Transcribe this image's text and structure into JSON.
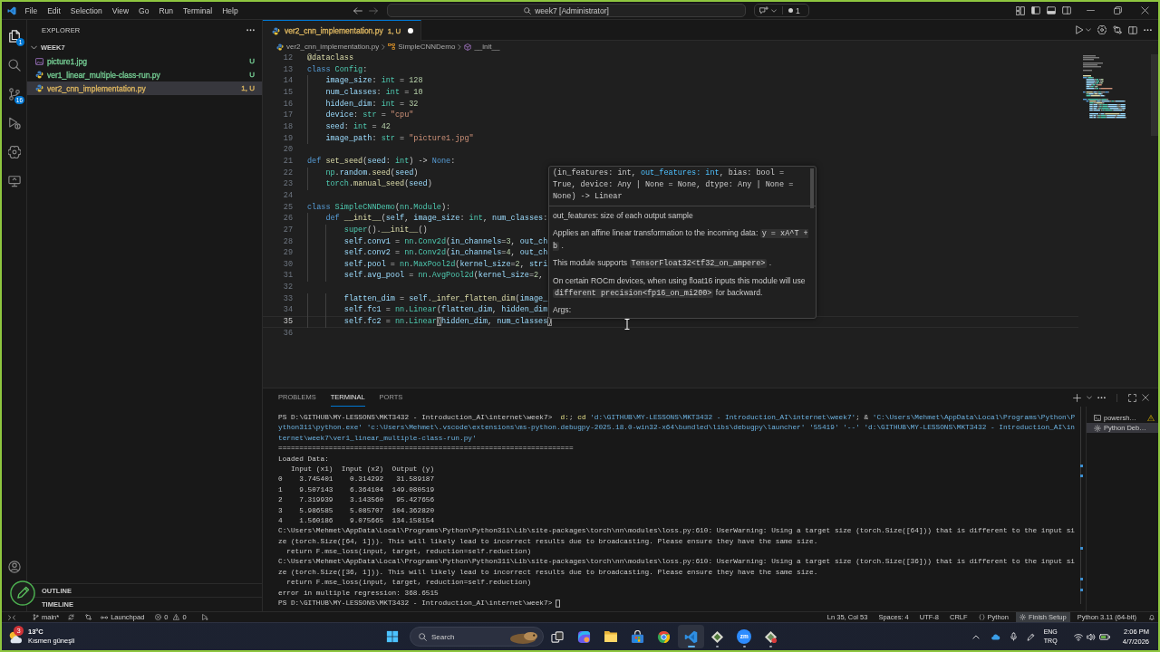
{
  "title_bar": {
    "menu": [
      "File",
      "Edit",
      "Selection",
      "View",
      "Go",
      "Run",
      "Terminal",
      "Help"
    ],
    "command_center": "week7 [Administrator]",
    "notification_count": "1"
  },
  "activity_bar": {
    "items": [
      {
        "kind": "files",
        "badge": "1",
        "selected": true
      },
      {
        "kind": "search",
        "selected": false
      },
      {
        "kind": "source_control",
        "badge": "16",
        "selected": false
      },
      {
        "kind": "run_debug",
        "selected": false
      },
      {
        "kind": "assistant",
        "selected": false
      },
      {
        "kind": "remote",
        "selected": false
      }
    ],
    "bottom": [
      {
        "kind": "account"
      }
    ]
  },
  "overlay_tool": {
    "kind": "pen"
  },
  "sidebar": {
    "title": "EXPLORER",
    "folder": {
      "name": "WEEK7",
      "expanded": true
    },
    "files": [
      {
        "kind": "image",
        "name": "picture1.jpg",
        "status": "U",
        "color": "#73c991",
        "selected": false
      },
      {
        "kind": "python",
        "name": "ver1_linear_multiple-class-run.py",
        "status": "U",
        "color": "#73c991",
        "selected": false
      },
      {
        "kind": "python",
        "name": "ver2_cnn_implementation.py",
        "status": "1, U",
        "color": "#d9b35f",
        "selected": true
      }
    ],
    "sections": [
      "OUTLINE",
      "TIMELINE"
    ]
  },
  "editor": {
    "tabs": [
      {
        "name": "ver2_cnn_implementation.py",
        "status": "1, U",
        "color": "#d9b35f",
        "modified": true,
        "selected": true
      }
    ],
    "breadcrumb": [
      {
        "kind": "file",
        "text": "ver2_cnn_implementation.py"
      },
      {
        "kind": "class",
        "text": "SimpleCNNDemo"
      },
      {
        "kind": "method",
        "text": "__init__"
      }
    ],
    "lines": [
      {
        "number": "12",
        "current": false,
        "tokens": [
          {
            "kind": "function",
            "text": "@dataclass"
          }
        ]
      },
      {
        "number": "13",
        "current": false,
        "tokens": [
          {
            "kind": "keyword",
            "text": "class"
          },
          {
            "kind": "type",
            "text": " Config"
          },
          {
            "kind": "plain",
            "text": ":"
          }
        ]
      },
      {
        "number": "14",
        "current": false,
        "tokens": [
          {
            "kind": "variable",
            "text": "    image_size"
          },
          {
            "kind": "plain",
            "text": ": "
          },
          {
            "kind": "type",
            "text": "int"
          },
          {
            "kind": "plain",
            "text": " = "
          },
          {
            "kind": "number",
            "text": "128"
          }
        ]
      },
      {
        "number": "15",
        "current": false,
        "tokens": [
          {
            "kind": "variable",
            "text": "    num_classes"
          },
          {
            "kind": "plain",
            "text": ": "
          },
          {
            "kind": "type",
            "text": "int"
          },
          {
            "kind": "plain",
            "text": " = "
          },
          {
            "kind": "number",
            "text": "10"
          }
        ]
      },
      {
        "number": "16",
        "current": false,
        "tokens": [
          {
            "kind": "variable",
            "text": "    hidden_dim"
          },
          {
            "kind": "plain",
            "text": ": "
          },
          {
            "kind": "type",
            "text": "int"
          },
          {
            "kind": "plain",
            "text": " = "
          },
          {
            "kind": "number",
            "text": "32"
          }
        ]
      },
      {
        "number": "17",
        "current": false,
        "tokens": [
          {
            "kind": "variable",
            "text": "    device"
          },
          {
            "kind": "plain",
            "text": ": "
          },
          {
            "kind": "type",
            "text": "str"
          },
          {
            "kind": "plain",
            "text": " = "
          },
          {
            "kind": "string",
            "text": "\"cpu\""
          }
        ]
      },
      {
        "number": "18",
        "current": false,
        "tokens": [
          {
            "kind": "variable",
            "text": "    seed"
          },
          {
            "kind": "plain",
            "text": ": "
          },
          {
            "kind": "type",
            "text": "int"
          },
          {
            "kind": "plain",
            "text": " = "
          },
          {
            "kind": "number",
            "text": "42"
          }
        ]
      },
      {
        "number": "19",
        "current": false,
        "tokens": [
          {
            "kind": "variable",
            "text": "    image_path"
          },
          {
            "kind": "plain",
            "text": ": "
          },
          {
            "kind": "type",
            "text": "str"
          },
          {
            "kind": "plain",
            "text": " = "
          },
          {
            "kind": "string",
            "text": "\"picture1.jpg\""
          }
        ]
      },
      {
        "number": "20",
        "current": false
      },
      {
        "number": "21",
        "current": false,
        "tokens": [
          {
            "kind": "keyword",
            "text": "def"
          },
          {
            "kind": "function",
            "text": " set_seed"
          },
          {
            "kind": "plain",
            "text": "("
          },
          {
            "kind": "variable",
            "text": "seed"
          },
          {
            "kind": "plain",
            "text": ": "
          },
          {
            "kind": "type",
            "text": "int"
          },
          {
            "kind": "plain",
            "text": ") -> "
          },
          {
            "kind": "keyword",
            "text": "None"
          },
          {
            "kind": "plain",
            "text": ":"
          }
        ]
      },
      {
        "number": "22",
        "current": false,
        "tokens": [
          {
            "kind": "type",
            "text": "    np"
          },
          {
            "kind": "plain",
            "text": "."
          },
          {
            "kind": "variable",
            "text": "random"
          },
          {
            "kind": "plain",
            "text": "."
          },
          {
            "kind": "function",
            "text": "seed"
          },
          {
            "kind": "plain",
            "text": "("
          },
          {
            "kind": "variable",
            "text": "seed"
          },
          {
            "kind": "plain",
            "text": ")"
          }
        ]
      },
      {
        "number": "23",
        "current": false,
        "tokens": [
          {
            "kind": "type",
            "text": "    torch"
          },
          {
            "kind": "plain",
            "text": "."
          },
          {
            "kind": "function",
            "text": "manual_seed"
          },
          {
            "kind": "plain",
            "text": "("
          },
          {
            "kind": "variable",
            "text": "seed"
          },
          {
            "kind": "plain",
            "text": ")"
          }
        ]
      },
      {
        "number": "24",
        "current": false
      },
      {
        "number": "25",
        "current": false,
        "tokens": [
          {
            "kind": "keyword",
            "text": "class"
          },
          {
            "kind": "type",
            "text": " SimpleCNNDemo"
          },
          {
            "kind": "plain",
            "text": "("
          },
          {
            "kind": "type",
            "text": "nn"
          },
          {
            "kind": "plain",
            "text": "."
          },
          {
            "kind": "type",
            "text": "Module"
          },
          {
            "kind": "plain",
            "text": "):"
          }
        ]
      },
      {
        "number": "26",
        "current": false,
        "tokens": [
          {
            "kind": "keyword",
            "text": "    def"
          },
          {
            "kind": "function",
            "text": " __init__"
          },
          {
            "kind": "plain",
            "text": "("
          },
          {
            "kind": "variable",
            "text": "self"
          },
          {
            "kind": "plain",
            "text": ", "
          },
          {
            "kind": "variable",
            "text": "image_size"
          },
          {
            "kind": "plain",
            "text": ": "
          },
          {
            "kind": "type",
            "text": "int"
          },
          {
            "kind": "plain",
            "text": ", "
          },
          {
            "kind": "variable",
            "text": "num_classes"
          },
          {
            "kind": "plain",
            "text": ":"
          }
        ]
      },
      {
        "number": "27",
        "current": false,
        "tokens": [
          {
            "kind": "type",
            "text": "        super"
          },
          {
            "kind": "plain",
            "text": "()."
          },
          {
            "kind": "function",
            "text": "__init__"
          },
          {
            "kind": "plain",
            "text": "()"
          }
        ]
      },
      {
        "number": "28",
        "current": false,
        "tokens": [
          {
            "kind": "variable",
            "text": "        self"
          },
          {
            "kind": "plain",
            "text": "."
          },
          {
            "kind": "variable",
            "text": "conv1"
          },
          {
            "kind": "plain",
            "text": " = "
          },
          {
            "kind": "type",
            "text": "nn"
          },
          {
            "kind": "plain",
            "text": "."
          },
          {
            "kind": "type",
            "text": "Conv2d"
          },
          {
            "kind": "plain",
            "text": "("
          },
          {
            "kind": "variable",
            "text": "in_channels"
          },
          {
            "kind": "plain",
            "text": "="
          },
          {
            "kind": "number",
            "text": "3"
          },
          {
            "kind": "plain",
            "text": ", "
          },
          {
            "kind": "variable",
            "text": "out_ch"
          }
        ]
      },
      {
        "number": "29",
        "current": false,
        "tokens": [
          {
            "kind": "variable",
            "text": "        self"
          },
          {
            "kind": "plain",
            "text": "."
          },
          {
            "kind": "variable",
            "text": "conv2"
          },
          {
            "kind": "plain",
            "text": " = "
          },
          {
            "kind": "type",
            "text": "nn"
          },
          {
            "kind": "plain",
            "text": "."
          },
          {
            "kind": "type",
            "text": "Conv2d"
          },
          {
            "kind": "plain",
            "text": "("
          },
          {
            "kind": "variable",
            "text": "in_channels"
          },
          {
            "kind": "plain",
            "text": "="
          },
          {
            "kind": "number",
            "text": "4"
          },
          {
            "kind": "plain",
            "text": ", "
          },
          {
            "kind": "variable",
            "text": "out_ch"
          }
        ]
      },
      {
        "number": "30",
        "current": false,
        "tokens": [
          {
            "kind": "variable",
            "text": "        self"
          },
          {
            "kind": "plain",
            "text": "."
          },
          {
            "kind": "variable",
            "text": "pool"
          },
          {
            "kind": "plain",
            "text": " = "
          },
          {
            "kind": "type",
            "text": "nn"
          },
          {
            "kind": "plain",
            "text": "."
          },
          {
            "kind": "type",
            "text": "MaxPool2d"
          },
          {
            "kind": "plain",
            "text": "("
          },
          {
            "kind": "variable",
            "text": "kernel_size"
          },
          {
            "kind": "plain",
            "text": "="
          },
          {
            "kind": "number",
            "text": "2"
          },
          {
            "kind": "plain",
            "text": ", "
          },
          {
            "kind": "variable",
            "text": "stri"
          }
        ]
      },
      {
        "number": "31",
        "current": false,
        "tokens": [
          {
            "kind": "variable",
            "text": "        self"
          },
          {
            "kind": "plain",
            "text": "."
          },
          {
            "kind": "variable",
            "text": "avg_pool"
          },
          {
            "kind": "plain",
            "text": " = "
          },
          {
            "kind": "type",
            "text": "nn"
          },
          {
            "kind": "plain",
            "text": "."
          },
          {
            "kind": "type",
            "text": "AvgPool2d"
          },
          {
            "kind": "plain",
            "text": "("
          },
          {
            "kind": "variable",
            "text": "kernel_size"
          },
          {
            "kind": "plain",
            "text": "="
          },
          {
            "kind": "number",
            "text": "2"
          },
          {
            "kind": "plain",
            "text": ","
          }
        ]
      },
      {
        "number": "32",
        "current": false
      },
      {
        "number": "33",
        "current": false,
        "tokens": [
          {
            "kind": "variable",
            "text": "        flatten_dim"
          },
          {
            "kind": "plain",
            "text": " = "
          },
          {
            "kind": "variable",
            "text": "self"
          },
          {
            "kind": "plain",
            "text": "."
          },
          {
            "kind": "function",
            "text": "_infer_flatten_dim"
          },
          {
            "kind": "plain",
            "text": "("
          },
          {
            "kind": "variable",
            "text": "image_"
          }
        ]
      },
      {
        "number": "34",
        "current": false,
        "tokens": [
          {
            "kind": "variable",
            "text": "        self"
          },
          {
            "kind": "plain",
            "text": "."
          },
          {
            "kind": "variable",
            "text": "fc1"
          },
          {
            "kind": "plain",
            "text": " = "
          },
          {
            "kind": "type",
            "text": "nn"
          },
          {
            "kind": "plain",
            "text": "."
          },
          {
            "kind": "type",
            "text": "Linear"
          },
          {
            "kind": "plain",
            "text": "("
          },
          {
            "kind": "variable",
            "text": "flatten_dim"
          },
          {
            "kind": "plain",
            "text": ", "
          },
          {
            "kind": "variable",
            "text": "hidden_dim"
          }
        ]
      },
      {
        "number": "35",
        "current": true,
        "tokens": [
          {
            "kind": "variable",
            "text": "        self"
          },
          {
            "kind": "plain",
            "text": "."
          },
          {
            "kind": "variable",
            "text": "fc2"
          },
          {
            "kind": "plain",
            "text": " = "
          },
          {
            "kind": "type",
            "text": "nn"
          },
          {
            "kind": "plain",
            "text": "."
          },
          {
            "kind": "type",
            "text": "Linear"
          },
          {
            "kind": "bracket",
            "text": "("
          },
          {
            "kind": "variable",
            "text": "hidden_dim"
          },
          {
            "kind": "plain",
            "text": ", "
          },
          {
            "kind": "variable",
            "text": "num_classes"
          },
          {
            "kind": "bracket",
            "text": ")"
          }
        ]
      },
      {
        "number": "36",
        "current": false
      }
    ],
    "hover": {
      "signature": [
        {
          "text": "(in_features: int, ",
          "active": false
        },
        {
          "text": "out_features: int",
          "active": true
        },
        {
          "text": ", bias: bool = True, device: Any | None = None, dtype: Any | None = None) -> Linear",
          "active": false
        }
      ],
      "paragraphs": [
        {
          "parts": [
            {
              "text": "out_features: size of each output sample",
              "code": false
            }
          ]
        },
        {
          "parts": [
            {
              "text": "Applies an affine linear transformation to the incoming data: ",
              "code": false
            },
            {
              "text": "y = xA^T + b",
              "code": true
            },
            {
              "text": " .",
              "code": false
            }
          ]
        },
        {
          "parts": [
            {
              "text": "This module supports ",
              "code": false
            },
            {
              "text": "TensorFloat32<tf32_on_ampere>",
              "code": true
            },
            {
              "text": " .",
              "code": false
            }
          ]
        },
        {
          "parts": [
            {
              "text": "On certain ROCm devices, when using float16 inputs this module will use ",
              "code": false
            },
            {
              "text": "different precision<fp16_on_mi200>",
              "code": true
            },
            {
              "text": " for backward.",
              "code": false
            }
          ]
        },
        {
          "parts": [
            {
              "text": "Args:",
              "code": false
            }
          ]
        }
      ]
    }
  },
  "panel": {
    "tabs": [
      {
        "label": "PROBLEMS",
        "selected": false
      },
      {
        "label": "TERMINAL",
        "selected": true
      },
      {
        "label": "PORTS",
        "selected": false
      }
    ],
    "terminal": {
      "cursor": true,
      "lines": [
        {
          "parts": [
            {
              "kind": "prompt",
              "text": "PS D:\\GITHUB\\MY-LESSONS\\MKT3432 - Introduction_AI\\internet\\week7>"
            },
            {
              "kind": "command",
              "text": "  d:"
            },
            {
              "kind": "plain",
              "text": "; "
            },
            {
              "kind": "command",
              "text": "cd"
            },
            {
              "kind": "string",
              "text": " 'd:\\GITHUB\\MY-LESSONS\\MKT3432 - Introduction_AI\\internet\\week7'"
            },
            {
              "kind": "plain",
              "text": "; & "
            },
            {
              "kind": "string",
              "text": "'C:\\Users\\Mehmet\\AppData\\Local\\Programs\\Python\\P"
            }
          ]
        },
        {
          "parts": [
            {
              "kind": "string",
              "text": "ython311\\python.exe' 'c:\\Users\\Mehmet\\.vscode\\extensions\\ms-python.debugpy-2025.18.0-win32-x64\\bundled\\libs\\debugpy\\launcher' '55419' '--' 'd:\\GITHUB\\MY-LESSONS\\MKT3432 - Introduction_AI\\in"
            }
          ]
        },
        {
          "parts": [
            {
              "kind": "string",
              "text": "ternet\\week7\\ver1_linear_multiple-class-run.py'"
            }
          ]
        },
        {
          "parts": [
            {
              "kind": "plain",
              "text": "======================================================================"
            }
          ]
        },
        {
          "parts": [
            {
              "kind": "plain",
              "text": "Loaded Data:"
            }
          ]
        },
        {
          "parts": [
            {
              "kind": "plain",
              "text": "   Input (x1)  Input (x2)  Output (y)"
            }
          ]
        },
        {
          "parts": [
            {
              "kind": "plain",
              "text": "0    3.745401    0.314292   31.589187"
            }
          ]
        },
        {
          "parts": [
            {
              "kind": "plain",
              "text": "1    9.507143    6.364104  149.080519"
            }
          ]
        },
        {
          "parts": [
            {
              "kind": "plain",
              "text": "2    7.319939    3.143560   95.427656"
            }
          ]
        },
        {
          "parts": [
            {
              "kind": "plain",
              "text": "3    5.986585    5.085707  104.362820"
            }
          ]
        },
        {
          "parts": [
            {
              "kind": "plain",
              "text": "4    1.560186    9.075665  134.158154"
            }
          ]
        },
        {
          "parts": [
            {
              "kind": "plain",
              "text": "C:\\Users\\Mehmet\\AppData\\Local\\Programs\\Python\\Python311\\Lib\\site-packages\\torch\\nn\\modules\\loss.py:610: UserWarning: Using a target size (torch.Size([64])) that is different to the input si"
            }
          ]
        },
        {
          "parts": [
            {
              "kind": "plain",
              "text": "ze (torch.Size([64, 1])). This will likely lead to incorrect results due to broadcasting. Please ensure they have the same size."
            }
          ]
        },
        {
          "parts": [
            {
              "kind": "plain",
              "text": "  return F.mse_loss(input, target, reduction=self.reduction)"
            }
          ]
        },
        {
          "parts": [
            {
              "kind": "plain",
              "text": "C:\\Users\\Mehmet\\AppData\\Local\\Programs\\Python\\Python311\\Lib\\site-packages\\torch\\nn\\modules\\loss.py:610: UserWarning: Using a target size (torch.Size([36])) that is different to the input si"
            }
          ]
        },
        {
          "parts": [
            {
              "kind": "plain",
              "text": "ze (torch.Size([36, 1])). This will likely lead to incorrect results due to broadcasting. Please ensure they have the same size."
            }
          ]
        },
        {
          "parts": [
            {
              "kind": "plain",
              "text": "  return F.mse_loss(input, target, reduction=self.reduction)"
            }
          ]
        },
        {
          "parts": [
            {
              "kind": "plain",
              "text": "error in multiple regression: 368.6515"
            }
          ]
        },
        {
          "parts": [
            {
              "kind": "prompt",
              "text": "PS D:\\GITHUB\\MY-LESSONS\\MKT3432 - Introduction_AI\\internet\\week7>"
            }
          ]
        }
      ]
    },
    "terminals": [
      {
        "kind": "shell",
        "label": "powersh…",
        "warning": true,
        "selected": false
      },
      {
        "kind": "debug",
        "label": "Python Deb…",
        "warning": false,
        "selected": true
      }
    ]
  },
  "status_bar": {
    "branch": "main*",
    "launchpad": "Launchpad",
    "errors": "0",
    "warnings": "0",
    "right": [
      {
        "kind": "plain",
        "text": "Ln 35, Col 53"
      },
      {
        "kind": "plain",
        "text": "Spaces: 4"
      },
      {
        "kind": "plain",
        "text": "UTF-8"
      },
      {
        "kind": "plain",
        "text": "CRLF"
      },
      {
        "kind": "language",
        "text": "Python"
      },
      {
        "kind": "setup",
        "text": "Finish Setup"
      },
      {
        "kind": "plain",
        "text": "Python 3.11 (64-bit)"
      }
    ]
  },
  "taskbar": {
    "weather": {
      "badge": "3",
      "temperature": "13°C",
      "condition": "Kısmen güneşli"
    },
    "search": "Search",
    "apps": [
      {
        "kind": "taskview",
        "active": false,
        "running": false
      },
      {
        "kind": "copilot",
        "active": false,
        "running": false
      },
      {
        "kind": "folder",
        "active": false,
        "running": false
      },
      {
        "kind": "store",
        "active": false,
        "running": false
      },
      {
        "kind": "browser",
        "active": false,
        "running": false
      },
      {
        "kind": "editor",
        "active": true,
        "running": true
      },
      {
        "kind": "tool",
        "active": false,
        "running": true
      },
      {
        "kind": "meeting",
        "label": "zm",
        "active": false,
        "running": true
      },
      {
        "kind": "paint",
        "active": false,
        "running": true
      }
    ],
    "tray": {
      "language": [
        "ENG",
        "TRQ"
      ],
      "time": "2:06 PM",
      "date": "4/7/2026"
    }
  }
}
